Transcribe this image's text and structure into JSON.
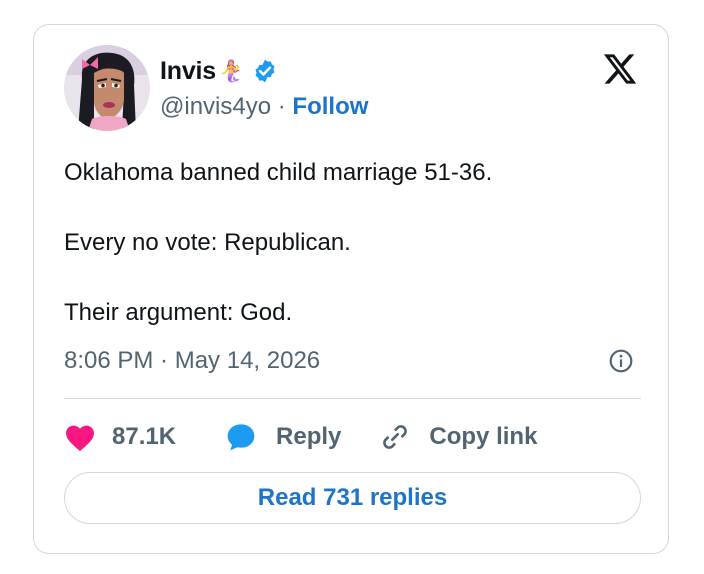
{
  "author": {
    "name": "Invis",
    "name_emoji": "🧜‍♀️",
    "handle": "@invis4yo",
    "separator": " · ",
    "follow_label": "Follow",
    "verified": true
  },
  "tweet": {
    "lines": [
      "Oklahoma banned child marriage 51-36.",
      "Every no vote: Republican.",
      "Their argument: God."
    ],
    "timestamp": "8:06 PM · May 14, 2026"
  },
  "actions": {
    "like_count": "87.1K",
    "reply_label": "Reply",
    "copy_label": "Copy link"
  },
  "read_replies_label": "Read 731 replies",
  "colors": {
    "accent_blue": "#1d74c9",
    "like_pink": "#f91880",
    "muted_text": "#536471",
    "border": "#cfd9de"
  },
  "icons": [
    "x-logo-icon",
    "verified-badge-icon",
    "info-icon",
    "heart-icon",
    "reply-bubble-icon",
    "link-icon"
  ]
}
